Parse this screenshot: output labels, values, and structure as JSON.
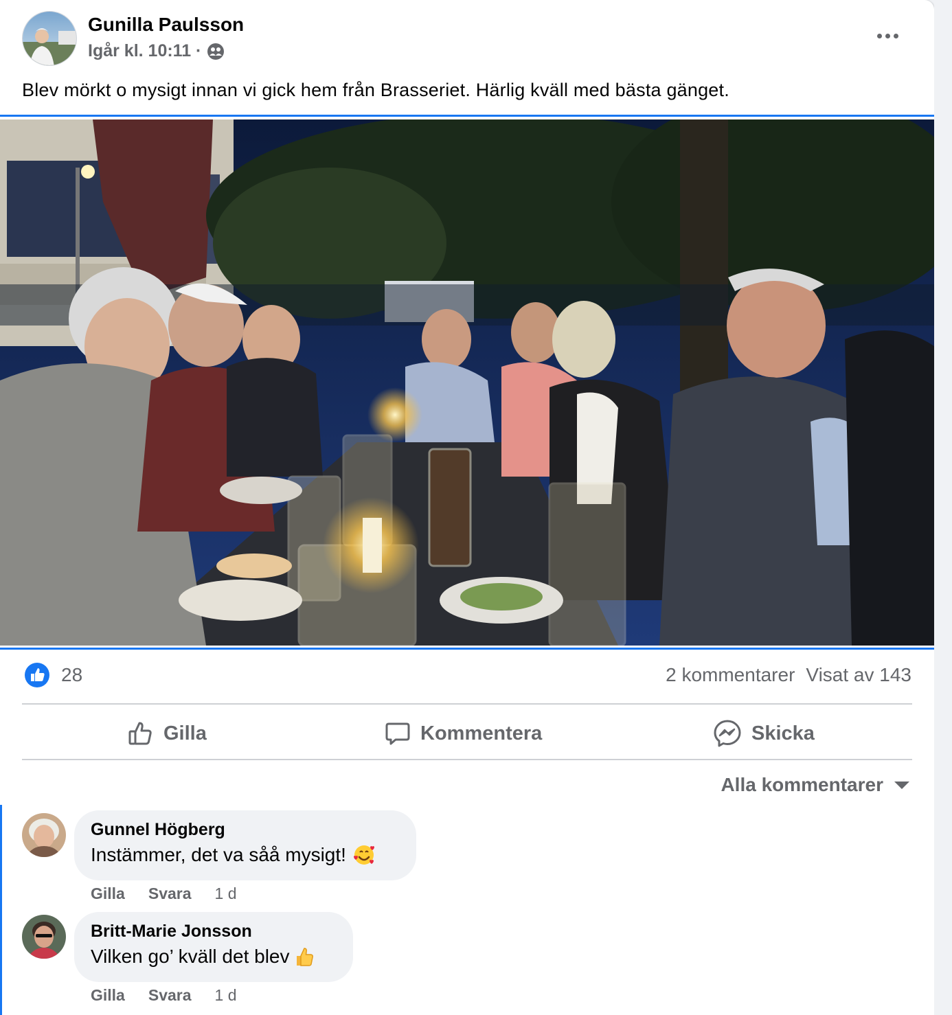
{
  "post": {
    "author": "Gunilla Paulsson",
    "timestamp": "Igår kl. 10:11 ·",
    "privacy_icon": "friends-icon",
    "text": "Blev mörkt o mysigt innan vi gick hem från Brasseriet. Härlig kväll med bästa gänget."
  },
  "stats": {
    "reactions": "28",
    "comments": "2 kommentarer",
    "views": "Visat av 143"
  },
  "actions": {
    "like": "Gilla",
    "comment": "Kommentera",
    "send": "Skicka"
  },
  "comment_sort": "Alla kommentarer",
  "comments": [
    {
      "name": "Gunnel Högberg",
      "text": "Instämmer, det va såå mysigt!",
      "emoji": "smiling-face-with-hearts-emoji",
      "like": "Gilla",
      "reply": "Svara",
      "time": "1 d"
    },
    {
      "name": "Britt-Marie Jonsson",
      "text": "Vilken go’ kväll det blev",
      "emoji": "thumbs-up-emoji",
      "like": "Gilla",
      "reply": "Svara",
      "time": "1 d"
    }
  ],
  "colors": {
    "accent": "#1877f2",
    "secondary_text": "#65676b",
    "bubble": "#f0f2f5"
  }
}
